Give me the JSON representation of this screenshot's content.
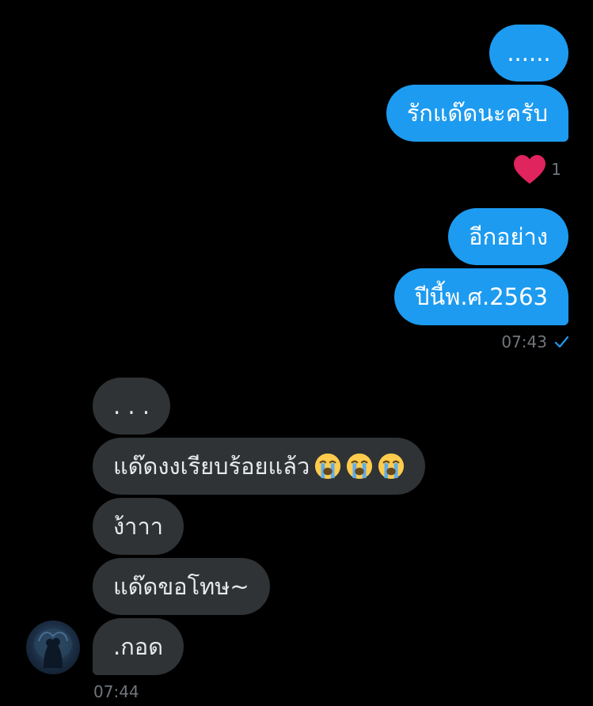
{
  "outgoing": [
    {
      "text": "......"
    },
    {
      "text": "รักแด๊ดนะครับ"
    },
    {
      "text": "อีกอย่าง"
    },
    {
      "text": "ปีนี้พ.ศ.2563"
    }
  ],
  "reaction": {
    "icon": "heart-icon",
    "count": "1",
    "color": "#e0245e"
  },
  "outgoing_time": "07:43",
  "outgoing_status_icon": "check-icon",
  "incoming": [
    {
      "text": ". . ."
    },
    {
      "text": "แด๊ดงงเรียบร้อยแล้ว",
      "emoji": [
        "loudly-crying-face",
        "loudly-crying-face",
        "loudly-crying-face"
      ]
    },
    {
      "text": "ง้าาา"
    },
    {
      "text": "แด๊ดขอโทษ~"
    },
    {
      "text": ".กอด"
    }
  ],
  "incoming_time": "07:44",
  "colors": {
    "background": "#000000",
    "outgoing_bubble": "#1d9bf0",
    "incoming_bubble": "#2f3336",
    "meta_text": "#71767b"
  }
}
